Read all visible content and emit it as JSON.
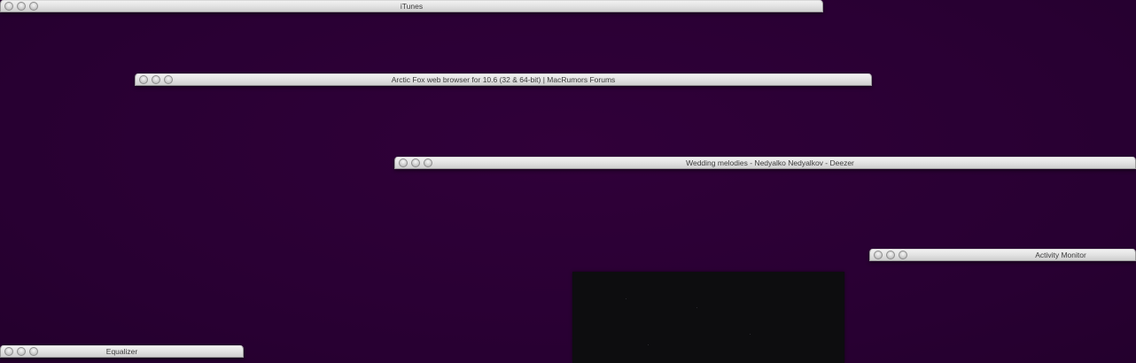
{
  "desktop": {
    "background_color": "#2a0033"
  },
  "windows": [
    {
      "title": "iTunes"
    },
    {
      "title": "Arctic Fox web browser for 10.6 (32 & 64-bit) | MacRumors Forums"
    },
    {
      "title": "Wedding melodies - Nedyalko Nedyalkov - Deezer"
    },
    {
      "title": "Activity Monitor"
    },
    {
      "title": "Equalizer"
    }
  ],
  "icons": {
    "close": "close-icon",
    "minimize": "minimize-icon",
    "zoom": "zoom-icon"
  }
}
